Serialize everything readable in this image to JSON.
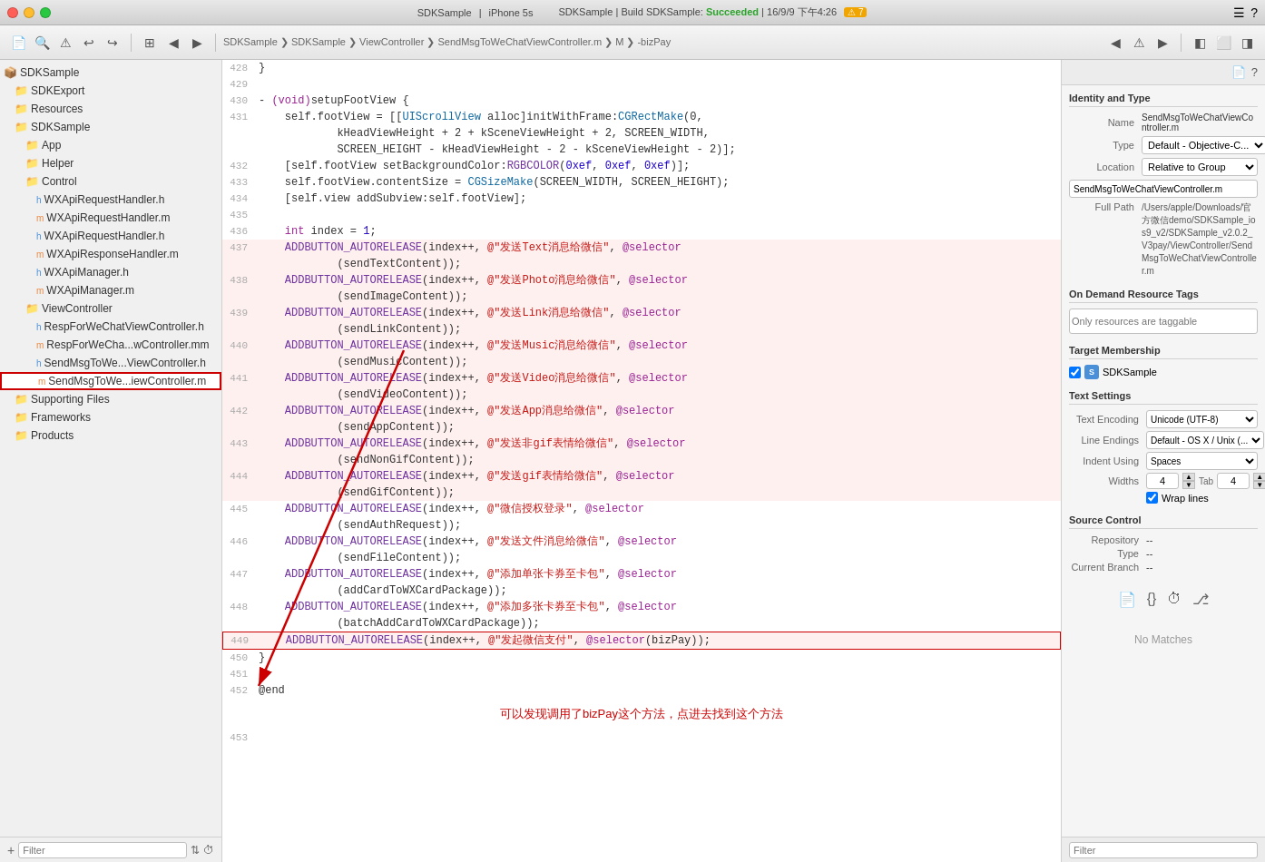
{
  "titleBar": {
    "appName": "SDKSample",
    "device": "iPhone 5s",
    "buildLabel": "SDKSample",
    "buildAction": "Build SDKSample:",
    "buildStatus": "Succeeded",
    "buildDate": "16/9/9",
    "buildTime": "下午4:26",
    "warningCount": "7"
  },
  "breadcrumb": {
    "items": [
      "SDKSample",
      "SDKSample",
      "ViewController",
      "SendMsgToWeChatViewController.m",
      "M",
      "-bizPay"
    ]
  },
  "sidebar": {
    "filterPlaceholder": "Filter",
    "items": [
      {
        "id": "SDKSample-root",
        "label": "SDKSample",
        "indent": 0,
        "type": "root",
        "icon": "📦"
      },
      {
        "id": "SDKExport",
        "label": "SDKExport",
        "indent": 1,
        "type": "folder",
        "icon": "📁"
      },
      {
        "id": "Resources",
        "label": "Resources",
        "indent": 1,
        "type": "folder",
        "icon": "📁"
      },
      {
        "id": "SDKSample",
        "label": "SDKSample",
        "indent": 1,
        "type": "folder",
        "icon": "📁"
      },
      {
        "id": "App",
        "label": "App",
        "indent": 2,
        "type": "folder",
        "icon": "📁"
      },
      {
        "id": "Helper",
        "label": "Helper",
        "indent": 2,
        "type": "folder",
        "icon": "📁"
      },
      {
        "id": "Control",
        "label": "Control",
        "indent": 2,
        "type": "folder",
        "icon": "📁"
      },
      {
        "id": "WXApiRequestHandler.h-1",
        "label": "WXApiRequestHandler.h",
        "indent": 3,
        "type": "header"
      },
      {
        "id": "WXApiRequestHandler.m-1",
        "label": "WXApiRequestHandler.m",
        "indent": 3,
        "type": "source"
      },
      {
        "id": "WXApiRequestHandler.h-2",
        "label": "WXApiRequestHandler.h",
        "indent": 3,
        "type": "header"
      },
      {
        "id": "WXApiResponseHandler.m",
        "label": "WXApiResponseHandler.m",
        "indent": 3,
        "type": "source"
      },
      {
        "id": "WXApiManager.h",
        "label": "WXApiManager.h",
        "indent": 3,
        "type": "header"
      },
      {
        "id": "WXApiManager.m",
        "label": "WXApiManager.m",
        "indent": 3,
        "type": "source"
      },
      {
        "id": "ViewController",
        "label": "ViewController",
        "indent": 2,
        "type": "folder",
        "icon": "📁"
      },
      {
        "id": "RespForWeChatViewController.h",
        "label": "RespForWeChatViewController.h",
        "indent": 3,
        "type": "header"
      },
      {
        "id": "RespForWeCha...wController.mm",
        "label": "RespForWeCha...wController.mm",
        "indent": 3,
        "type": "source"
      },
      {
        "id": "SendMsgToWe...ViewController.h",
        "label": "SendMsgToWe...ViewController.h",
        "indent": 3,
        "type": "header"
      },
      {
        "id": "SendMsgToWe...iewController.m",
        "label": "SendMsgToWe...iewController.m",
        "indent": 3,
        "type": "source",
        "selected": true
      },
      {
        "id": "SupportingFiles",
        "label": "Supporting Files",
        "indent": 1,
        "type": "folder",
        "icon": "📁"
      },
      {
        "id": "Frameworks",
        "label": "Frameworks",
        "indent": 1,
        "type": "folder",
        "icon": "📁"
      },
      {
        "id": "Products",
        "label": "Products",
        "indent": 1,
        "type": "folder",
        "icon": "📁"
      }
    ]
  },
  "codeEditor": {
    "lines": [
      {
        "num": 428,
        "content": "}"
      },
      {
        "num": 429,
        "content": ""
      },
      {
        "num": 430,
        "content": "- (void)setupFootView {"
      },
      {
        "num": 431,
        "content": "    self.footView = [[UIScrollView alloc]initWithFrame:CGRectMake(0,",
        "colors": {
          "UIScrollView": "type",
          "alloc": "kw",
          "initWithFrame": "kw",
          "CGRectMake": "type"
        }
      },
      {
        "num": "",
        "content": "            kHeadViewHeight + 2 + kSceneViewHeight + 2, SCREEN_WIDTH,"
      },
      {
        "num": "",
        "content": "            SCREEN_HEIGHT - kHeadViewHeight - 2 - kSceneViewHeight - 2)];"
      },
      {
        "num": 432,
        "content": "    [self.footView setBackgroundColor:RGBCOLOR(0xef, 0xef, 0xef)];"
      },
      {
        "num": 433,
        "content": "    self.footView.contentSize = CGSizeMake(SCREEN_WIDTH, SCREEN_HEIGHT);"
      },
      {
        "num": 434,
        "content": "    [self.view addSubview:self.footView];"
      },
      {
        "num": 435,
        "content": ""
      },
      {
        "num": 436,
        "content": "    int index = 1;"
      },
      {
        "num": 437,
        "content": "    ADDBUTTON_AUTORELEASE(index++, @\"发送Text消息给微信\", @selector",
        "red": true
      },
      {
        "num": "",
        "content": "            (sendTextContent));",
        "red": true
      },
      {
        "num": 438,
        "content": "    ADDBUTTON_AUTORELEASE(index++, @\"发送Photo消息给微信\", @selector",
        "red": true
      },
      {
        "num": "",
        "content": "            (sendImageContent));",
        "red": true
      },
      {
        "num": 439,
        "content": "    ADDBUTTON_AUTORELEASE(index++, @\"发送Link消息给微信\", @selector",
        "red": true
      },
      {
        "num": "",
        "content": "            (sendLinkContent));",
        "red": true
      },
      {
        "num": 440,
        "content": "    ADDBUTTON_AUTORELEASE(index++, @\"发送Music消息给微信\", @selector",
        "red": true
      },
      {
        "num": "",
        "content": "            (sendMusicContent));",
        "red": true
      },
      {
        "num": 441,
        "content": "    ADDBUTTON_AUTORELEASE(index++, @\"发送Video消息给微信\", @selector",
        "red": true
      },
      {
        "num": "",
        "content": "            (sendVideoContent));",
        "red": true
      },
      {
        "num": 442,
        "content": "    ADDBUTTON_AUTORELEASE(index++, @\"发送App消息给微信\", @selector",
        "red": true
      },
      {
        "num": "",
        "content": "            (sendAppContent));",
        "red": true
      },
      {
        "num": 443,
        "content": "    ADDBUTTON_AUTORELEASE(index++, @\"发送非gif表情给微信\", @selector",
        "red": true
      },
      {
        "num": "",
        "content": "            (sendNonGifContent));",
        "red": true
      },
      {
        "num": 444,
        "content": "    ADDBUTTON_AUTORELEASE(index++, @\"发送gif表情给微信\", @selector",
        "red": true
      },
      {
        "num": "",
        "content": "            (sendGifContent));",
        "red": true
      },
      {
        "num": 445,
        "content": "    ADDBUTTON_AUTORELEASE(index++, @\"微信授权登录\", @selector"
      },
      {
        "num": "",
        "content": "            (sendAuthRequest));"
      },
      {
        "num": 446,
        "content": "    ADDBUTTON_AUTORELEASE(index++, @\"发送文件消息给微信\", @selector"
      },
      {
        "num": "",
        "content": "            (sendFileContent));"
      },
      {
        "num": 447,
        "content": "    ADDBUTTON_AUTORELEASE(index++, @\"添加单张卡券至卡包\", @selector"
      },
      {
        "num": "",
        "content": "            (addCardToWXCardPackage));"
      },
      {
        "num": 448,
        "content": "    ADDBUTTON_AUTORELEASE(index++, @\"添加多张卡券至卡包\", @selector"
      },
      {
        "num": "",
        "content": "            (batchAddCardToWXCardPackage));"
      },
      {
        "num": 449,
        "content": "    ADDBUTTON_AUTORELEASE(index++, @\"发起微信支付\", @selector(bizPay));",
        "selected": true
      },
      {
        "num": 450,
        "content": "}"
      },
      {
        "num": 451,
        "content": ""
      },
      {
        "num": 452,
        "content": "@end"
      },
      {
        "num": 453,
        "content": ""
      }
    ],
    "annotation": "可以发现调用了bizPay这个方法，点进去找到这个方法"
  },
  "rightPanel": {
    "topIcons": [
      "file-icon",
      "code-icon",
      "history-icon",
      "branch-icon"
    ],
    "sections": {
      "identityAndType": {
        "title": "Identity and Type",
        "name": "SendMsgToWeChatViewController.m",
        "type": "Default - Objective-C...",
        "location": "Relative to Group",
        "locationValue": "SendMsgToWeChatViewController.m",
        "fullPath": "/Users/apple/Downloads/官方微信demo/SDKSample_ios9_v2/SDKSample_v2.0.2_V3pay/ViewController/SendMsgToWeChatViewController.m"
      },
      "onDemandResourceTags": {
        "title": "On Demand Resource Tags",
        "placeholder": "Only resources are taggable"
      },
      "targetMembership": {
        "title": "Target Membership",
        "targets": [
          {
            "name": "SDKSample",
            "checked": true
          }
        ]
      },
      "textSettings": {
        "title": "Text Settings",
        "textEncoding": "Unicode (UTF-8)",
        "lineEndings": "Default - OS X / Unix (...",
        "indentUsing": "Spaces",
        "tabWidth": "4",
        "indentWidth": "4",
        "wrapLines": true
      },
      "sourceControl": {
        "title": "Source Control",
        "repository": "--",
        "type": "--",
        "currentBranch": "--"
      }
    },
    "noMatches": "No Matches",
    "filterPlaceholder": "Filter"
  }
}
